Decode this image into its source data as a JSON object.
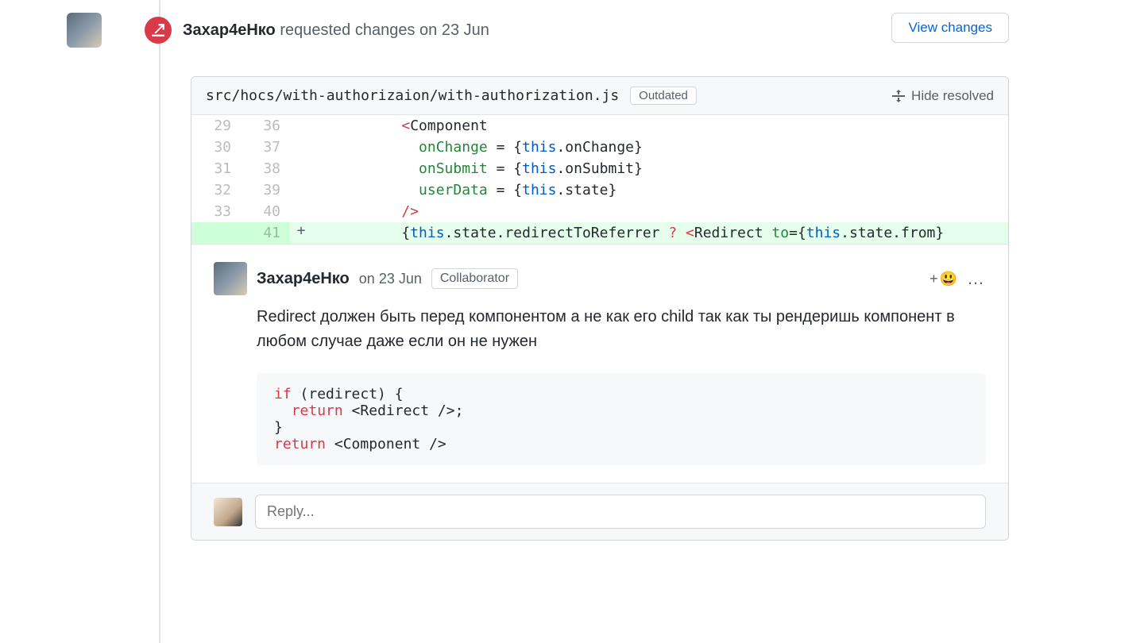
{
  "review": {
    "author": "Захар4еНко",
    "action": "requested changes on",
    "date": "23 Jun",
    "view_changes": "View changes"
  },
  "file": {
    "path": "src/hocs/with-authorizaion/with-authorization.js",
    "outdated": "Outdated",
    "hide_resolved": "Hide resolved"
  },
  "diff": {
    "lines": [
      {
        "old": "29",
        "new": "36",
        "marker": " ",
        "added": false,
        "tokens": [
          {
            "t": "          ",
            "c": ""
          },
          {
            "t": "<",
            "c": "tok-punc"
          },
          {
            "t": "Component",
            "c": "tok-tag"
          }
        ]
      },
      {
        "old": "30",
        "new": "37",
        "marker": " ",
        "added": false,
        "tokens": [
          {
            "t": "            ",
            "c": ""
          },
          {
            "t": "onChange",
            "c": "tok-attr"
          },
          {
            "t": " = {",
            "c": ""
          },
          {
            "t": "this",
            "c": "tok-this"
          },
          {
            "t": ".onChange}",
            "c": ""
          }
        ]
      },
      {
        "old": "31",
        "new": "38",
        "marker": " ",
        "added": false,
        "tokens": [
          {
            "t": "            ",
            "c": ""
          },
          {
            "t": "onSubmit",
            "c": "tok-attr"
          },
          {
            "t": " = {",
            "c": ""
          },
          {
            "t": "this",
            "c": "tok-this"
          },
          {
            "t": ".onSubmit}",
            "c": ""
          }
        ]
      },
      {
        "old": "32",
        "new": "39",
        "marker": " ",
        "added": false,
        "tokens": [
          {
            "t": "            ",
            "c": ""
          },
          {
            "t": "userData",
            "c": "tok-attr"
          },
          {
            "t": " = {",
            "c": ""
          },
          {
            "t": "this",
            "c": "tok-this"
          },
          {
            "t": ".state}",
            "c": ""
          }
        ]
      },
      {
        "old": "33",
        "new": "40",
        "marker": " ",
        "added": false,
        "tokens": [
          {
            "t": "          ",
            "c": ""
          },
          {
            "t": "/>",
            "c": "tok-punc"
          }
        ]
      },
      {
        "old": "",
        "new": "41",
        "marker": "+",
        "added": true,
        "tokens": [
          {
            "t": "          {",
            "c": ""
          },
          {
            "t": "this",
            "c": "tok-this"
          },
          {
            "t": ".state.redirectToReferrer ",
            "c": ""
          },
          {
            "t": "?",
            "c": "tok-punc"
          },
          {
            "t": " ",
            "c": ""
          },
          {
            "t": "<",
            "c": "tok-punc"
          },
          {
            "t": "Redirect ",
            "c": "tok-tag"
          },
          {
            "t": "to",
            "c": "tok-attr"
          },
          {
            "t": "={",
            "c": ""
          },
          {
            "t": "this",
            "c": "tok-this"
          },
          {
            "t": ".state.from}",
            "c": ""
          }
        ]
      }
    ]
  },
  "comment": {
    "author": "Захар4еНко",
    "when_prefix": "on",
    "date": "23 Jun",
    "role": "Collaborator",
    "body": "Redirect должен быть перед компонентом а не как его child так как ты рендеришь компонент в любом случае даже если он не нужен",
    "add_reaction": "+",
    "snippet_tokens": [
      {
        "t": "if",
        "c": "kw"
      },
      {
        "t": " (redirect) {\n  ",
        "c": ""
      },
      {
        "t": "return",
        "c": "kw"
      },
      {
        "t": " <Redirect />;\n}\n",
        "c": ""
      },
      {
        "t": "return",
        "c": "kw"
      },
      {
        "t": " <Component />",
        "c": ""
      }
    ]
  },
  "reply": {
    "placeholder": "Reply..."
  }
}
